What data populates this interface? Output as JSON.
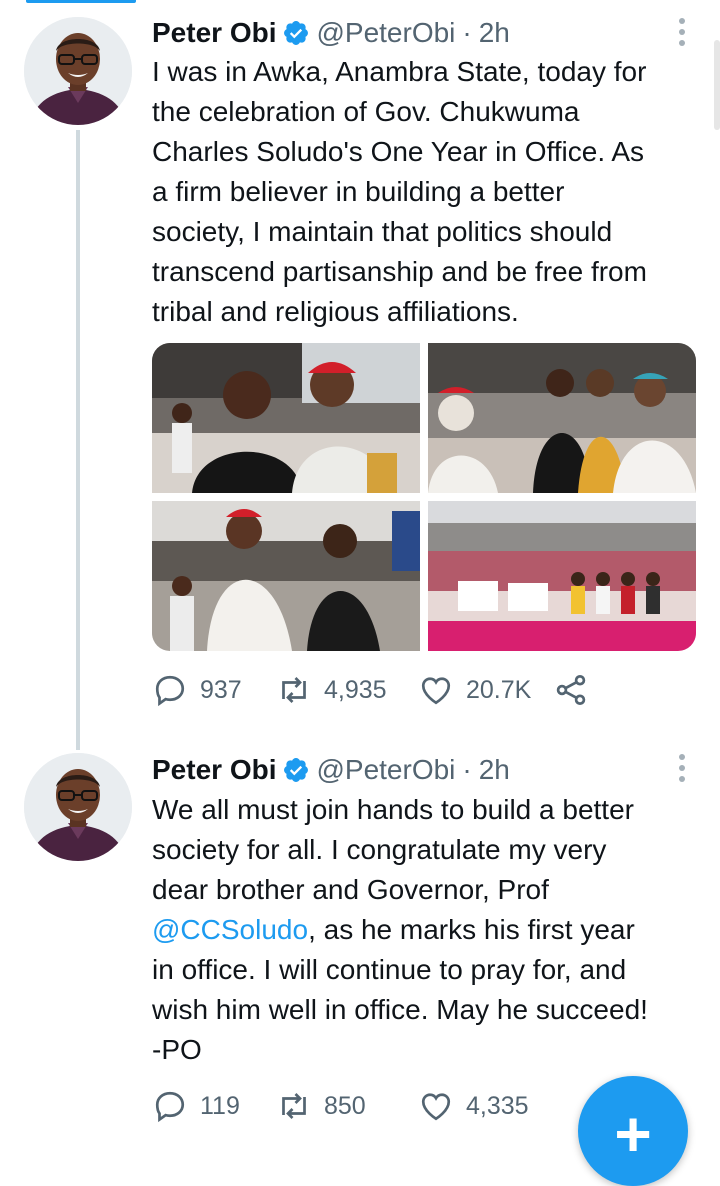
{
  "colors": {
    "accent": "#1d9bf0",
    "muted": "#536471",
    "text": "#0f1419"
  },
  "tweets": [
    {
      "name": "Peter Obi",
      "handle": "@PeterObi",
      "separator": "·",
      "time": "2h",
      "text": "I was in Awka, Anambra State, today for\nthe celebration of Gov. Chukwuma\nCharles Soludo's One Year in Office. As\na firm believer in building a better\nsociety, I maintain that politics should\ntranscend partisanship and be free from\ntribal and religious affiliations.",
      "replies": "937",
      "retweets": "4,935",
      "likes": "20.7K",
      "icons": [
        "reply-icon",
        "retweet-icon",
        "like-icon",
        "share-icon"
      ]
    },
    {
      "name": "Peter Obi",
      "handle": "@PeterObi",
      "separator": "·",
      "time": "2h",
      "text_before": "We all must join hands to build a better\nsociety for all. I congratulate my very\ndear brother and Governor, Prof\n",
      "mention": "@CCSoludo",
      "text_after": ", as he marks his first year\nin office. I will continue to pray for, and\nwish him well in office. May he succeed!\n-PO",
      "replies": "119",
      "retweets": "850",
      "likes": "4,335"
    }
  ],
  "compose_button": {
    "icon": "+"
  }
}
